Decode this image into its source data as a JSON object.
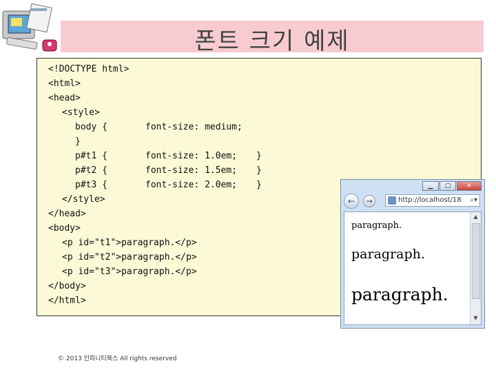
{
  "slide": {
    "title": "폰트 크기 예제",
    "footer": "© 2013 인피니티북스 All rights reserved"
  },
  "code": {
    "lines": [
      "<!DOCTYPE html>",
      "<html>",
      "<head>",
      "<style>",
      "body {",
      "}",
      "p#t1 {",
      "p#t2 {",
      "p#t3 {",
      "</style>",
      "</head>",
      "<body>",
      "<p id=\"t1\">paragraph.</p>",
      "<p id=\"t2\">paragraph.</p>",
      "<p id=\"t3\">paragraph.</p>",
      "</body>",
      "</html>"
    ],
    "body_rule": "font-size: medium;",
    "t1_rule": "font-size: 1.0em;",
    "t2_rule": "font-size: 1.5em;",
    "t3_rule": "font-size: 2.0em;",
    "t1_close": "}",
    "t2_close": "}",
    "t3_close": "}"
  },
  "browser": {
    "address": "http://localhost/",
    "address_suffix": "18",
    "paragraphs": [
      "paragraph.",
      "paragraph.",
      "paragraph."
    ]
  }
}
